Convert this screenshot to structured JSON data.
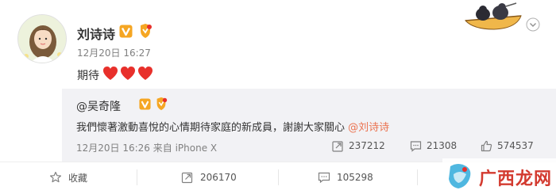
{
  "post": {
    "author": "刘诗诗",
    "time": "12月20日 16:27",
    "text": "期待"
  },
  "repost": {
    "user": "@吴奇隆",
    "text_main": "我們懷著激動喜悅的心情期待家庭的新成員，謝謝大家關心",
    "mention": "@刘诗诗",
    "time_source": "12月20日 16:26 来自 iPhone X",
    "forward_count": "237212",
    "comment_count": "21308",
    "like_count": "574537"
  },
  "actions": {
    "favorite_label": "收藏",
    "forward_count": "206170",
    "comment_count": "105298"
  },
  "icons": {
    "verified": "verified-v-badge-icon",
    "medal": "medal-badge-icon",
    "heart": "heart-icon",
    "more": "chevron-down-icon",
    "star": "star-icon",
    "forward": "forward-icon",
    "comment": "comment-icon",
    "like": "thumbs-up-icon"
  },
  "colors": {
    "accent": "#eb7350",
    "verified": "#f5a623",
    "heart": "#e8302b",
    "quote_bg": "#f2f2f5"
  }
}
